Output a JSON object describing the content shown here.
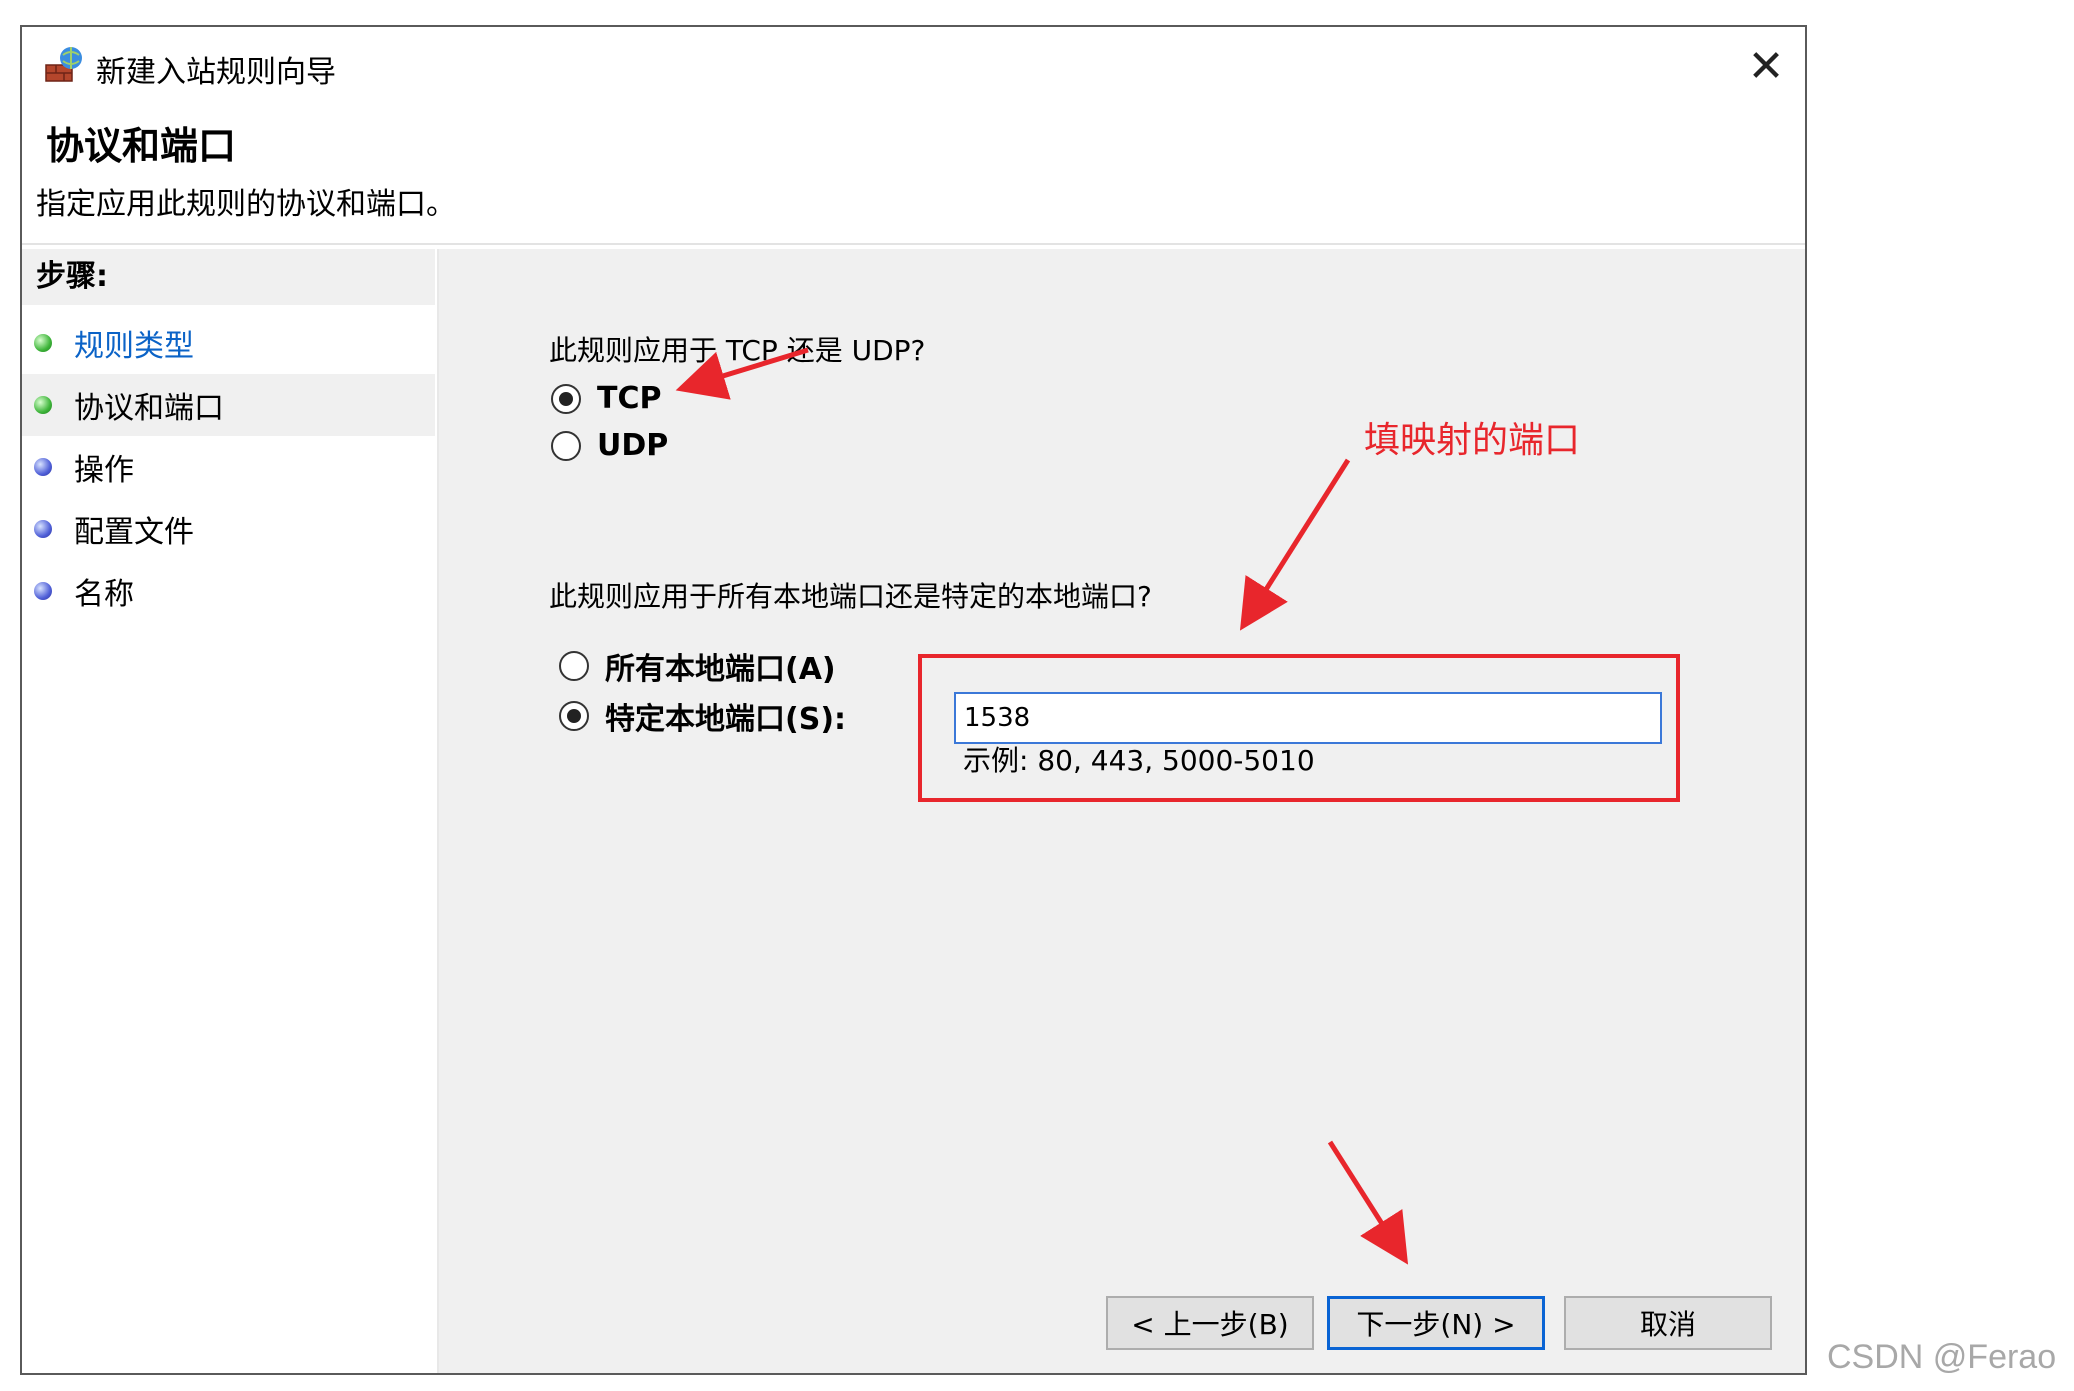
{
  "window": {
    "title": "新建入站规则向导",
    "close_glyph": "✕",
    "header_title": "协议和端口",
    "header_description": "指定应用此规则的协议和端口。"
  },
  "steps": {
    "heading": "步骤:",
    "items": [
      {
        "label": "规则类型",
        "state": "link"
      },
      {
        "label": "协议和端口",
        "state": "current"
      },
      {
        "label": "操作",
        "state": "pending"
      },
      {
        "label": "配置文件",
        "state": "pending"
      },
      {
        "label": "名称",
        "state": "pending"
      }
    ]
  },
  "protocol": {
    "question": "此规则应用于 TCP 还是 UDP?",
    "options": [
      {
        "label": "TCP",
        "selected": true
      },
      {
        "label": "UDP",
        "selected": false
      }
    ]
  },
  "ports": {
    "question": "此规则应用于所有本地端口还是特定的本地端口?",
    "options": [
      {
        "label": "所有本地端口(A)",
        "selected": false
      },
      {
        "label": "特定本地端口(S):",
        "selected": true
      }
    ],
    "value": "1538",
    "example": "示例: 80, 443, 5000-5010"
  },
  "annotation": {
    "text": "填映射的端口",
    "color": "#e8262c"
  },
  "buttons": {
    "back": "< 上一步(B)",
    "next": "下一步(N) >",
    "cancel": "取消"
  },
  "watermark": "CSDN @Ferao",
  "colors": {
    "accent": "#0a64d4",
    "link": "#0b63c7",
    "annotation_red": "#e8262c",
    "panel_bg": "#f0f0f0"
  },
  "icons": [
    "firewall-icon",
    "close-icon",
    "step-bullet-icon",
    "radio-icon",
    "arrow-icon"
  ]
}
